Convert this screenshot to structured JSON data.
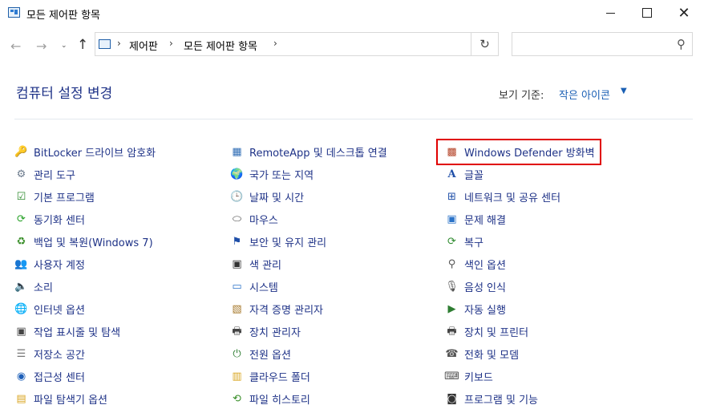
{
  "window": {
    "title": "모든 제어판 항목",
    "controls": [
      "minimize",
      "maximize",
      "close"
    ]
  },
  "navigation": {
    "back_icon": "back-arrow-icon",
    "forward_icon": "forward-arrow-icon",
    "recent_icon": "chevron-down-icon",
    "up_icon": "up-arrow-icon",
    "breadcrumb": [
      "제어판",
      "모든 제어판 항목"
    ],
    "search_placeholder": ""
  },
  "header": {
    "title": "컴퓨터 설정 변경",
    "view_by_label": "보기 기준:",
    "view_by_value": "작은 아이콘"
  },
  "items": {
    "col1": [
      {
        "label": "BitLocker 드라이브 암호화",
        "icon": "bitlocker-key-icon"
      },
      {
        "label": "관리 도구",
        "icon": "admin-tools-icon"
      },
      {
        "label": "기본 프로그램",
        "icon": "default-programs-icon"
      },
      {
        "label": "동기화 센터",
        "icon": "sync-center-icon"
      },
      {
        "label": "백업 및 복원(Windows 7)",
        "icon": "backup-restore-icon"
      },
      {
        "label": "사용자 계정",
        "icon": "user-accounts-icon"
      },
      {
        "label": "소리",
        "icon": "speaker-icon"
      },
      {
        "label": "인터넷 옵션",
        "icon": "internet-options-icon"
      },
      {
        "label": "작업 표시줄 및 탐색",
        "icon": "taskbar-icon"
      },
      {
        "label": "저장소 공간",
        "icon": "storage-spaces-icon"
      },
      {
        "label": "접근성 센터",
        "icon": "ease-of-access-icon"
      },
      {
        "label": "파일 탐색기 옵션",
        "icon": "folder-options-icon"
      }
    ],
    "col2": [
      {
        "label": "RemoteApp 및 데스크톱 연결",
        "icon": "remoteapp-icon"
      },
      {
        "label": "국가 또는 지역",
        "icon": "globe-icon"
      },
      {
        "label": "날짜 및 시간",
        "icon": "clock-icon"
      },
      {
        "label": "마우스",
        "icon": "mouse-icon"
      },
      {
        "label": "보안 및 유지 관리",
        "icon": "flag-icon"
      },
      {
        "label": "색 관리",
        "icon": "color-management-icon"
      },
      {
        "label": "시스템",
        "icon": "system-icon"
      },
      {
        "label": "자격 증명 관리자",
        "icon": "credential-manager-icon"
      },
      {
        "label": "장치 관리자",
        "icon": "device-manager-icon"
      },
      {
        "label": "전원 옵션",
        "icon": "power-options-icon"
      },
      {
        "label": "클라우드 폴더",
        "icon": "work-folders-icon"
      },
      {
        "label": "파일 히스토리",
        "icon": "file-history-icon"
      }
    ],
    "col3": [
      {
        "label": "Windows Defender 방화벽",
        "icon": "firewall-icon"
      },
      {
        "label": "글꼴",
        "icon": "fonts-icon"
      },
      {
        "label": "네트워크 및 공유 센터",
        "icon": "network-icon"
      },
      {
        "label": "문제 해결",
        "icon": "troubleshooting-icon"
      },
      {
        "label": "복구",
        "icon": "recovery-icon"
      },
      {
        "label": "색인 옵션",
        "icon": "indexing-options-icon"
      },
      {
        "label": "음성 인식",
        "icon": "microphone-icon"
      },
      {
        "label": "자동 실행",
        "icon": "autoplay-icon"
      },
      {
        "label": "장치 및 프린터",
        "icon": "printer-icon"
      },
      {
        "label": "전화 및 모뎀",
        "icon": "phone-modem-icon"
      },
      {
        "label": "키보드",
        "icon": "keyboard-icon"
      },
      {
        "label": "프로그램 및 기능",
        "icon": "programs-features-icon"
      }
    ]
  },
  "highlight": {
    "target": "Windows Defender 방화벽",
    "color": "#e00000"
  },
  "colors": {
    "link": "#1e3287",
    "accent": "#1a5fb4",
    "divider": "#e4e8ee"
  }
}
